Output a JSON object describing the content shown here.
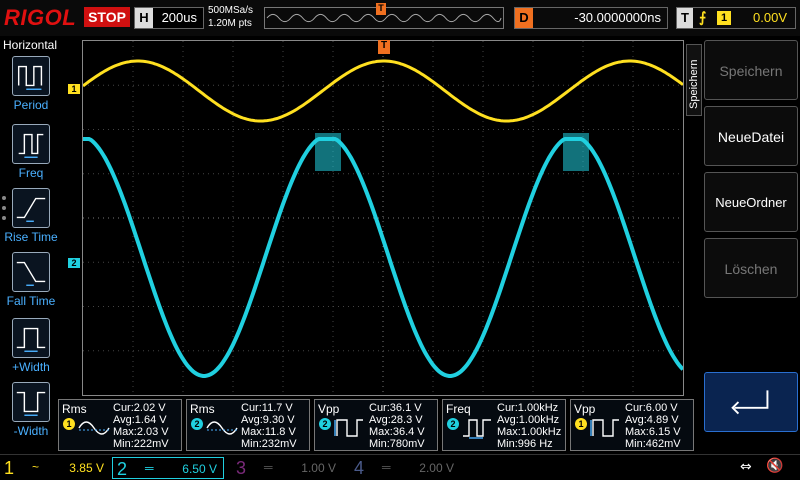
{
  "top": {
    "brand": "RIGOL",
    "run_state": "STOP",
    "timebase_key": "H",
    "timebase_value": "200us",
    "sample_rate": "500MSa/s",
    "memory_depth": "1.20M pts",
    "delay_key": "D",
    "delay_value": "-30.0000000ns",
    "trigger_key": "T",
    "trigger_edge": "⨍",
    "trigger_channel": "1",
    "trigger_level": "0.00V",
    "trigger_marker": "T"
  },
  "left_menu": {
    "title": "Horizontal",
    "items": [
      {
        "label": "Period",
        "icon": "period-icon"
      },
      {
        "label": "Freq",
        "icon": "frequency-icon"
      },
      {
        "label": "Rise Time",
        "icon": "rise-time-icon"
      },
      {
        "label": "Fall Time",
        "icon": "fall-time-icon"
      },
      {
        "label": "+Width",
        "icon": "positive-width-icon"
      },
      {
        "label": "-Width",
        "icon": "negative-width-icon"
      }
    ]
  },
  "channels_markers": {
    "ch1": "1",
    "ch2": "2"
  },
  "measurements": [
    {
      "name": "Rms",
      "channel": "1",
      "cur": "Cur:2.02 V",
      "avg": "Avg:1.64 V",
      "max": "Max:2.03 V",
      "min": "Min:222mV",
      "icon": "rms-icon"
    },
    {
      "name": "Rms",
      "channel": "2",
      "cur": "Cur:11.7 V",
      "avg": "Avg:9.30 V",
      "max": "Max:11.8 V",
      "min": "Min:232mV",
      "icon": "rms-icon"
    },
    {
      "name": "Vpp",
      "channel": "2",
      "cur": "Cur:36.1 V",
      "avg": "Avg:28.3 V",
      "max": "Max:36.4 V",
      "min": "Min:780mV",
      "icon": "vpp-icon"
    },
    {
      "name": "Freq",
      "channel": "2",
      "cur": "Cur:1.00kHz",
      "avg": "Avg:1.00kHz",
      "max": "Max:1.00kHz",
      "min": "Min:996 Hz",
      "icon": "frequency-icon"
    },
    {
      "name": "Vpp",
      "channel": "1",
      "cur": "Cur:6.00 V",
      "avg": "Avg:4.89 V",
      "max": "Max:6.15 V",
      "min": "Min:462mV",
      "icon": "vpp-icon"
    }
  ],
  "right_panel": {
    "tab_label": "Speichern",
    "buttons": [
      {
        "label": "Speichern",
        "enabled": false
      },
      {
        "label": "NeueDatei",
        "enabled": true
      },
      {
        "label": "NeueOrdner",
        "enabled": true
      },
      {
        "label": "Löschen",
        "enabled": false
      }
    ],
    "back_icon": "return-arrow-icon"
  },
  "bottom": {
    "channels": [
      {
        "num": "1",
        "coupling": "~",
        "scale": "3.85 V",
        "color": "#ffe020",
        "active": true
      },
      {
        "num": "2",
        "coupling": "═",
        "scale": "6.50 V",
        "color": "#20d0e0",
        "active": true
      },
      {
        "num": "3",
        "coupling": "═",
        "scale": "1.00 V",
        "color": "#c020c0",
        "active": false
      },
      {
        "num": "4",
        "coupling": "═",
        "scale": "2.00 V",
        "color": "#2060ff",
        "active": false
      }
    ],
    "usb_icon": "usb-icon",
    "speaker_icon": "speaker-muted-icon"
  },
  "colors": {
    "ch1": "#ffe020",
    "ch2": "#20d0e0",
    "trigger": "#f07020",
    "brand": "#e01010"
  }
}
